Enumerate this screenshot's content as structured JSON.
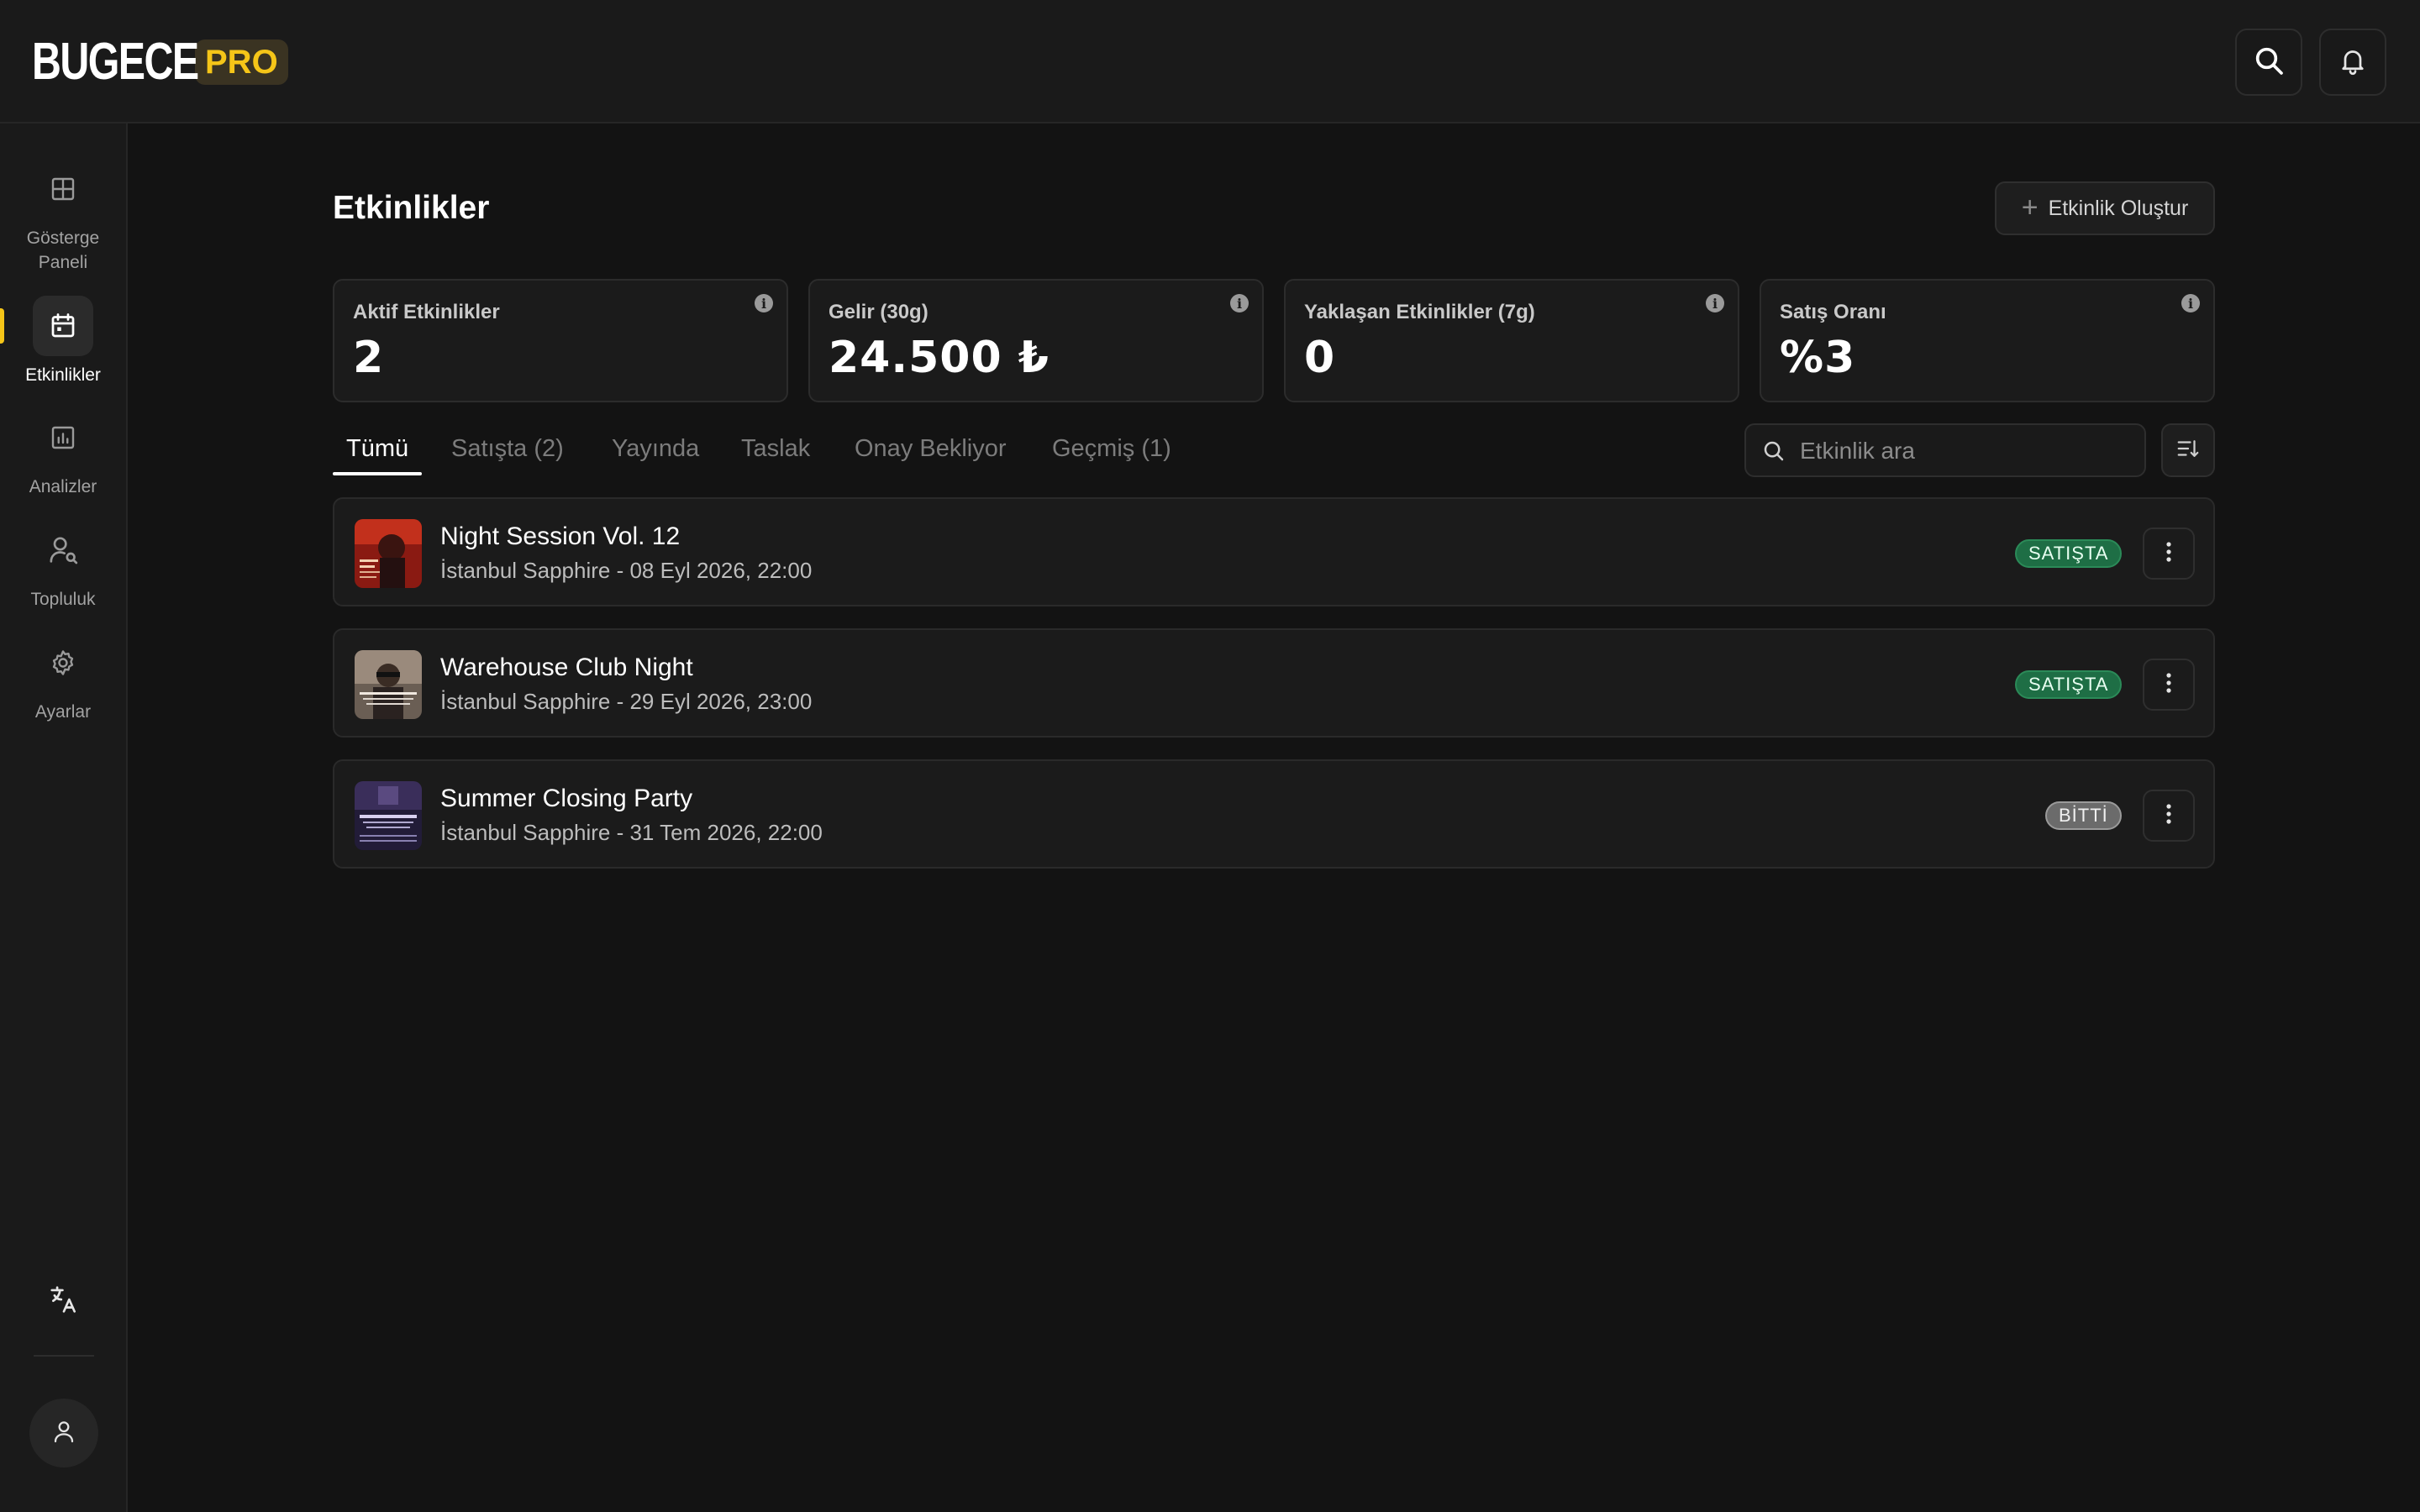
{
  "brand": {
    "name": "BUGECE",
    "badge": "PRO"
  },
  "header": {
    "search_icon": "search-icon",
    "bell_icon": "bell-icon"
  },
  "sidebar": {
    "items": [
      {
        "label": "Gösterge Paneli",
        "icon": "grid-icon",
        "active": false
      },
      {
        "label": "Etkinlikler",
        "icon": "calendar-icon",
        "active": true
      },
      {
        "label": "Analizler",
        "icon": "chart-icon",
        "active": false
      },
      {
        "label": "Topluluk",
        "icon": "user-search-icon",
        "active": false
      },
      {
        "label": "Ayarlar",
        "icon": "gear-icon",
        "active": false
      }
    ],
    "language_icon": "translate-icon",
    "profile_icon": "user-icon"
  },
  "page": {
    "title": "Etkinlikler",
    "create_button": "Etkinlik Oluştur"
  },
  "stats": [
    {
      "label": "Aktif Etkinlikler",
      "value": "2"
    },
    {
      "label": "Gelir (30g)",
      "value": "24.500 ₺"
    },
    {
      "label": "Yaklaşan Etkinlikler (7g)",
      "value": "0"
    },
    {
      "label": "Satış Oranı",
      "value": "%3"
    }
  ],
  "tabs": [
    {
      "label": "Tümü",
      "active": true
    },
    {
      "label": "Satışta (2)",
      "active": false
    },
    {
      "label": "Yayında",
      "active": false
    },
    {
      "label": "Taslak",
      "active": false
    },
    {
      "label": "Onay Bekliyor",
      "active": false
    },
    {
      "label": "Geçmiş (1)",
      "active": false
    }
  ],
  "search": {
    "placeholder": "Etkinlik ara",
    "value": ""
  },
  "events": [
    {
      "title": "Night Session Vol. 12",
      "subtitle": "İstanbul Sapphire - 08 Eyl 2026, 22:00",
      "status": "SATIŞTA",
      "status_color": "#1e6e45"
    },
    {
      "title": "Warehouse Club Night",
      "subtitle": "İstanbul Sapphire - 29 Eyl 2026, 23:00",
      "status": "SATIŞTA",
      "status_color": "#1e6e45"
    },
    {
      "title": "Summer Closing Party",
      "subtitle": "İstanbul Sapphire - 31 Tem 2026, 22:00",
      "status": "BİTTİ",
      "status_color": "#6b6b6b"
    }
  ],
  "colors": {
    "accent": "#f5c518",
    "background": "#131313",
    "surface": "#1b1b1b"
  }
}
